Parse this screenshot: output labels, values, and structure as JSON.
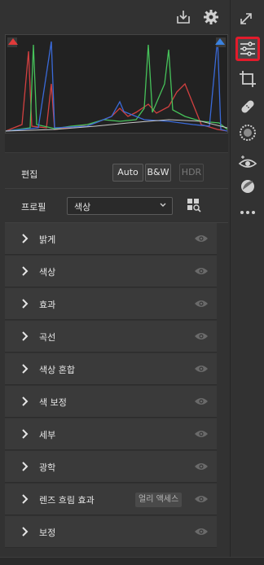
{
  "toolbar": {
    "export_icon": "export-icon",
    "settings_icon": "gear-icon",
    "expand_icon": "expand-icon"
  },
  "histogram": {
    "shadow_clip_color": "#e03a3a",
    "highlight_clip_color": "#3a82e0"
  },
  "edit": {
    "title": "편집",
    "auto_label": "Auto",
    "bw_label": "B&W",
    "hdr_label": "HDR"
  },
  "profile": {
    "label": "프로필",
    "value": "색상"
  },
  "panels": [
    {
      "label": "밝게"
    },
    {
      "label": "색상"
    },
    {
      "label": "효과"
    },
    {
      "label": "곡선"
    },
    {
      "label": "색상 혼합"
    },
    {
      "label": "색 보정"
    },
    {
      "label": "세부"
    },
    {
      "label": "광학"
    },
    {
      "label": "렌즈 흐림 효과",
      "badge": "얼리 액세스"
    },
    {
      "label": "보정"
    }
  ],
  "tools": [
    {
      "icon": "sliders-icon",
      "active": true
    },
    {
      "icon": "crop-icon"
    },
    {
      "icon": "healing-icon"
    },
    {
      "icon": "masking-icon"
    },
    {
      "icon": "red-eye-icon"
    },
    {
      "icon": "presets-icon"
    },
    {
      "icon": "more-icon"
    }
  ],
  "colors": {
    "active_highlight": "#e21b2b",
    "panel_bg": "#3a3a3a",
    "app_bg": "#323232"
  }
}
